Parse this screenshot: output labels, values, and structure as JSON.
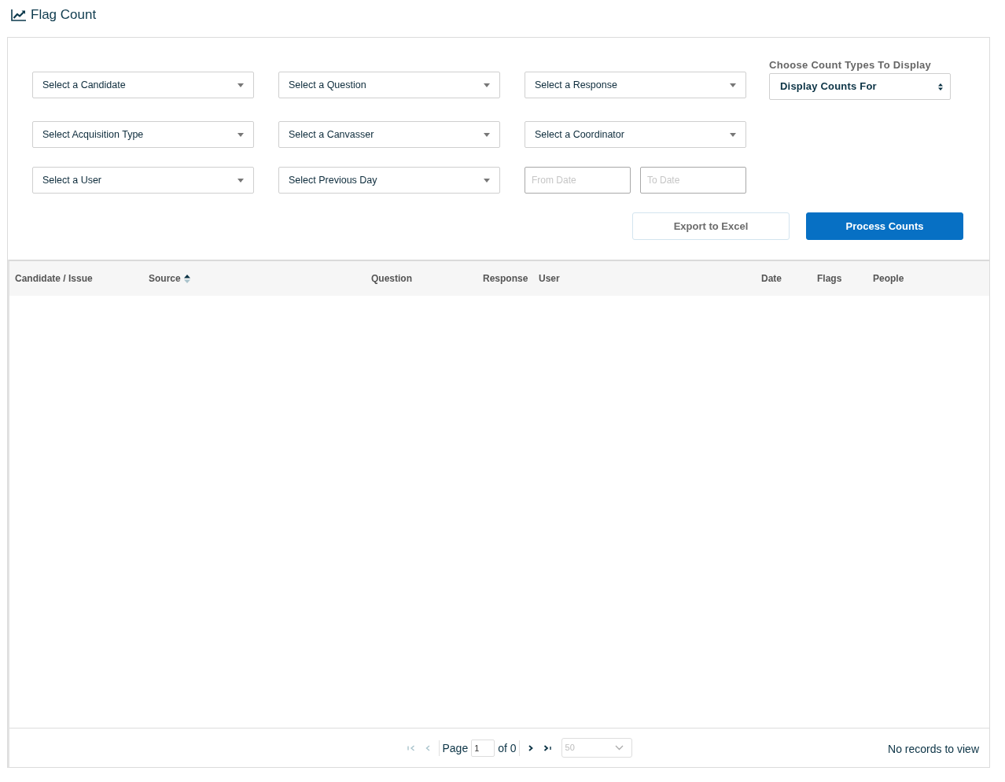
{
  "header": {
    "title": "Flag Count"
  },
  "filter_rows": [
    {
      "fields": [
        {
          "kind": "select",
          "text": "Select a Candidate"
        },
        {
          "kind": "select",
          "text": "Select a Question"
        },
        {
          "kind": "select",
          "text": "Select a Response"
        }
      ]
    },
    {
      "fields": [
        {
          "kind": "select",
          "text": "Select Acquisition Type"
        },
        {
          "kind": "select",
          "text": "Select a Canvasser"
        },
        {
          "kind": "select",
          "text": "Select a Coordinator"
        }
      ]
    },
    {
      "fields": [
        {
          "kind": "select",
          "text": "Select a User"
        },
        {
          "kind": "select",
          "text": "Select Previous Day"
        },
        {
          "kind": "date",
          "placeholder": "From Date"
        },
        {
          "kind": "date",
          "placeholder": "To Date"
        }
      ]
    }
  ],
  "count_types": {
    "label": "Choose Count Types To Display",
    "value": "Display Counts For"
  },
  "actions": [
    {
      "kind": "secondary",
      "label": "Export to Excel"
    },
    {
      "kind": "primary",
      "label": "Process Counts"
    }
  ],
  "table": {
    "columns": [
      {
        "label": "Candidate / Issue",
        "sorted": false
      },
      {
        "label": "Source",
        "sorted": true
      },
      {
        "label": "Question",
        "sorted": false
      },
      {
        "label": "Response",
        "sorted": false
      },
      {
        "label": "User",
        "sorted": false
      },
      {
        "label": "Date",
        "sorted": false
      },
      {
        "label": "Flags",
        "sorted": false
      },
      {
        "label": "People",
        "sorted": false
      }
    ]
  },
  "pager": {
    "nav": [
      {
        "kind": "first",
        "disabled": true
      },
      {
        "kind": "prev",
        "disabled": true
      },
      {
        "kind": "next",
        "disabled": false
      },
      {
        "kind": "last",
        "disabled": false
      }
    ],
    "page_label": "Page",
    "page_value": "1",
    "total_label": "of 0",
    "page_size": {
      "value": "50",
      "disabled": true
    },
    "status": "No records to view"
  }
}
